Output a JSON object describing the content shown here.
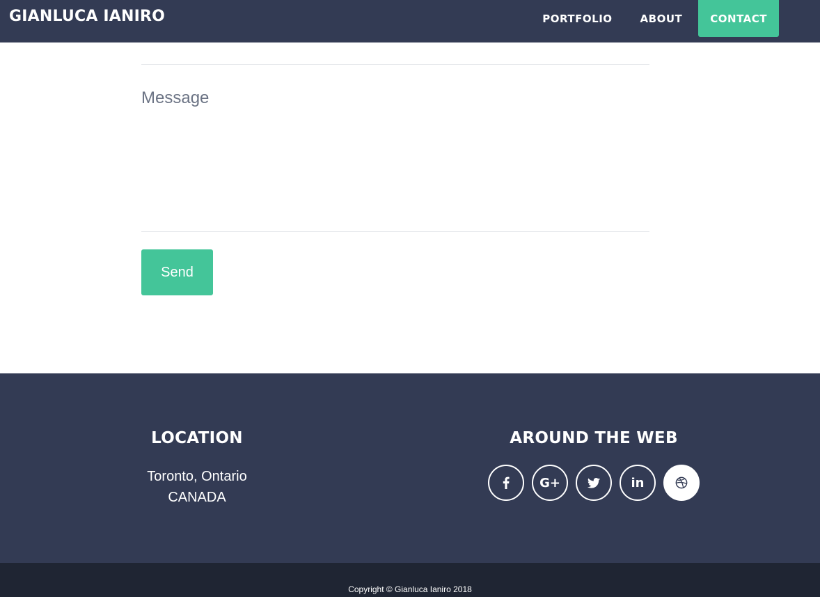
{
  "navbar": {
    "brand": "GIANLUCA IANIRO",
    "links": [
      {
        "label": "PORTFOLIO"
      },
      {
        "label": "ABOUT"
      },
      {
        "label": "CONTACT"
      }
    ]
  },
  "form": {
    "message_placeholder": "Message",
    "message_value": "",
    "send_label": "Send"
  },
  "footer": {
    "location": {
      "heading": "LOCATION",
      "line1": "Toronto, Ontario",
      "line2": "CANADA"
    },
    "web": {
      "heading": "AROUND THE WEB",
      "icons": [
        "facebook-icon",
        "google-plus-icon",
        "twitter-icon",
        "linkedin-icon",
        "dribbble-icon"
      ],
      "google_plus_glyph": "G+",
      "linkedin_glyph": "in"
    }
  },
  "copyright": "Copyright © Gianluca Ianiro 2018",
  "colors": {
    "navy": "#333b54",
    "accent": "#44c599",
    "dark_footer": "#1f2533"
  }
}
